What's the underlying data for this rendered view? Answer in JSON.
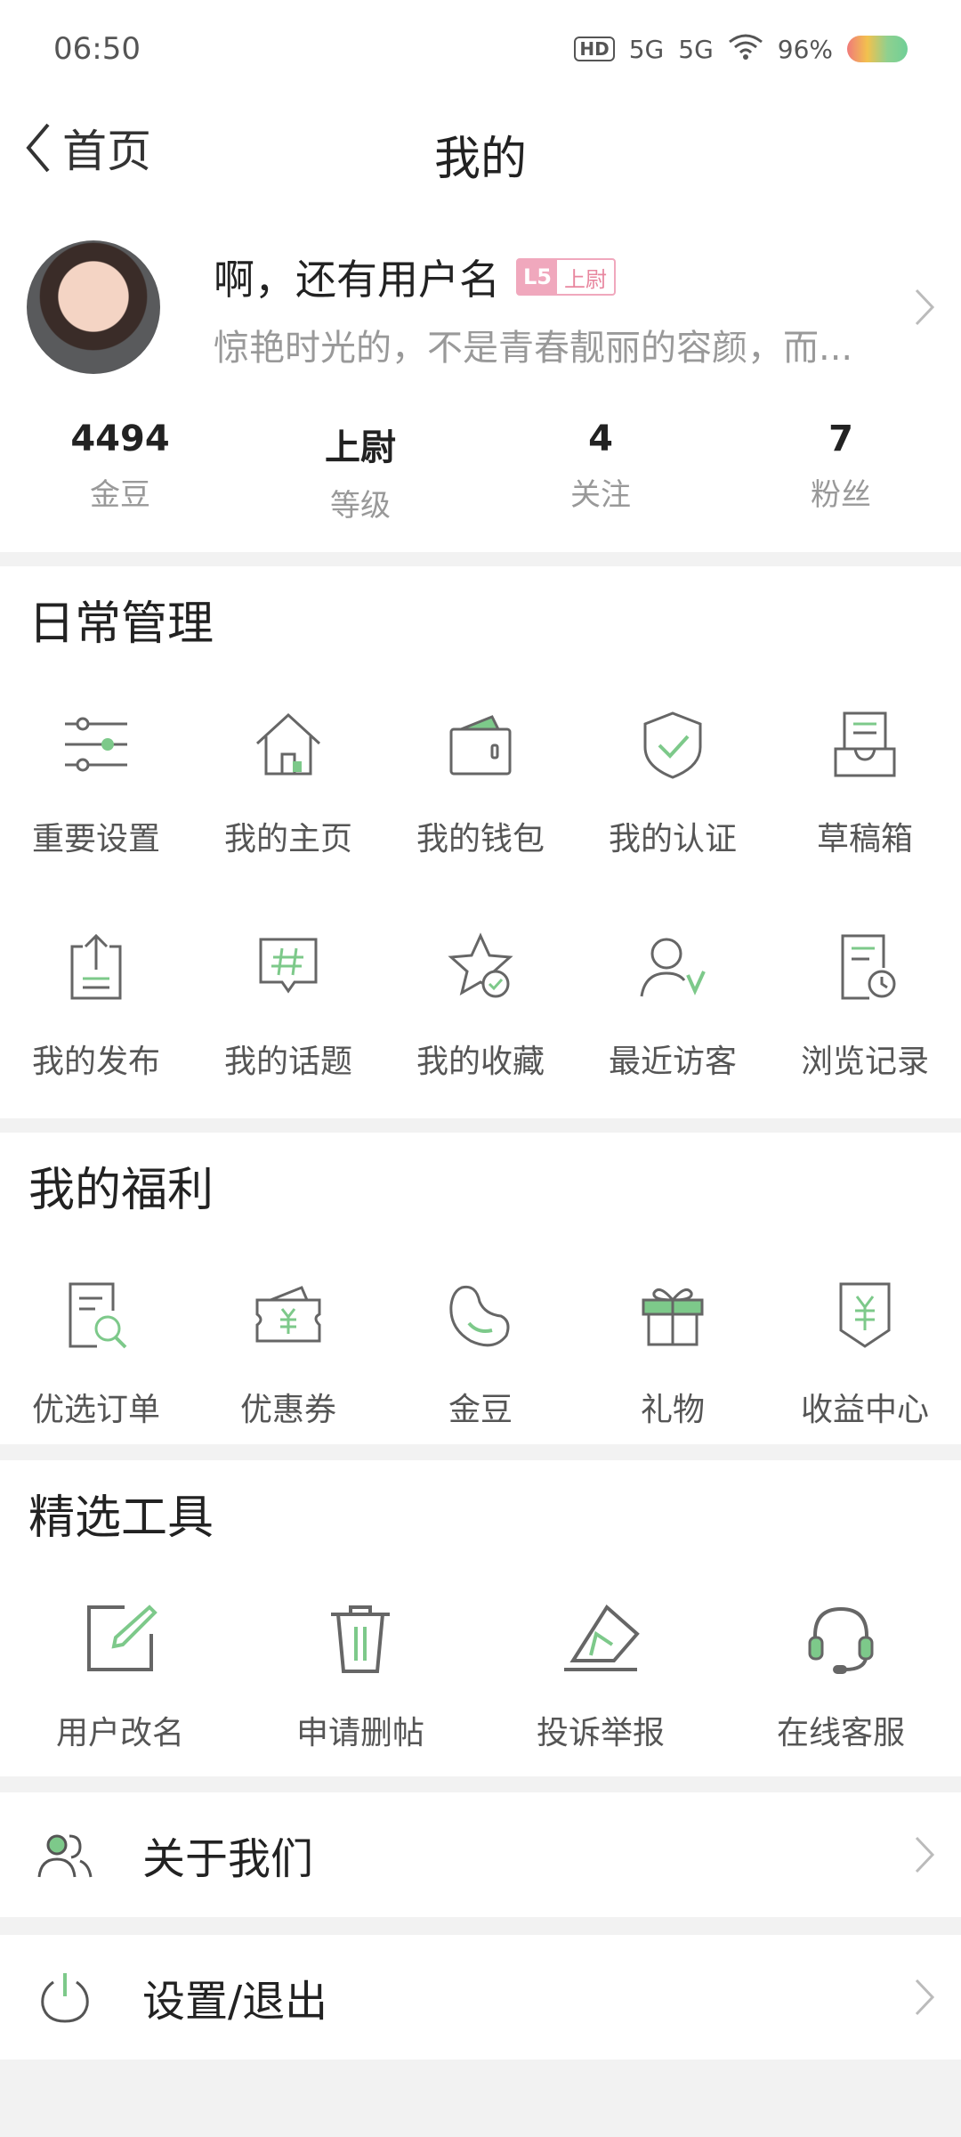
{
  "status": {
    "time": "06:50",
    "hd": "HD",
    "sig1": "5G",
    "sig2": "5G",
    "battery": "96%"
  },
  "nav": {
    "back": "首页",
    "title": "我的"
  },
  "profile": {
    "username": "啊，还有用户名",
    "level_badge": "L5",
    "level_name": "上尉",
    "bio": "惊艳时光的，不是青春靓丽的容颜，而..."
  },
  "stats": [
    {
      "value": "4494",
      "label": "金豆"
    },
    {
      "value": "上尉",
      "label": "等级"
    },
    {
      "value": "4",
      "label": "关注"
    },
    {
      "value": "7",
      "label": "粉丝"
    }
  ],
  "daily": {
    "title": "日常管理",
    "row1": [
      {
        "label": "重要设置",
        "icon": "sliders-icon"
      },
      {
        "label": "我的主页",
        "icon": "home-icon"
      },
      {
        "label": "我的钱包",
        "icon": "wallet-icon"
      },
      {
        "label": "我的认证",
        "icon": "shield-check-icon"
      },
      {
        "label": "草稿箱",
        "icon": "inbox-icon"
      }
    ],
    "row2": [
      {
        "label": "我的发布",
        "icon": "upload-doc-icon"
      },
      {
        "label": "我的话题",
        "icon": "hashtag-icon"
      },
      {
        "label": "我的收藏",
        "icon": "star-check-icon"
      },
      {
        "label": "最近访客",
        "icon": "visitor-icon"
      },
      {
        "label": "浏览记录",
        "icon": "history-icon"
      }
    ]
  },
  "welfare": {
    "title": "我的福利",
    "items": [
      {
        "label": "优选订单",
        "icon": "order-search-icon"
      },
      {
        "label": "优惠券",
        "icon": "coupon-icon"
      },
      {
        "label": "金豆",
        "icon": "bean-icon"
      },
      {
        "label": "礼物",
        "icon": "gift-icon"
      },
      {
        "label": "收益中心",
        "icon": "revenue-icon"
      }
    ]
  },
  "tools": {
    "title": "精选工具",
    "items": [
      {
        "label": "用户改名",
        "icon": "edit-icon"
      },
      {
        "label": "申请删帖",
        "icon": "trash-icon"
      },
      {
        "label": "投诉举报",
        "icon": "report-icon"
      },
      {
        "label": "在线客服",
        "icon": "headset-icon"
      }
    ]
  },
  "rows": [
    {
      "label": "关于我们",
      "icon": "users-icon"
    },
    {
      "label": "设置/退出",
      "icon": "power-icon"
    }
  ],
  "colors": {
    "accent": "#7dc98a",
    "icon_stroke": "#666666",
    "badge_pink": "#f0a8bd"
  }
}
